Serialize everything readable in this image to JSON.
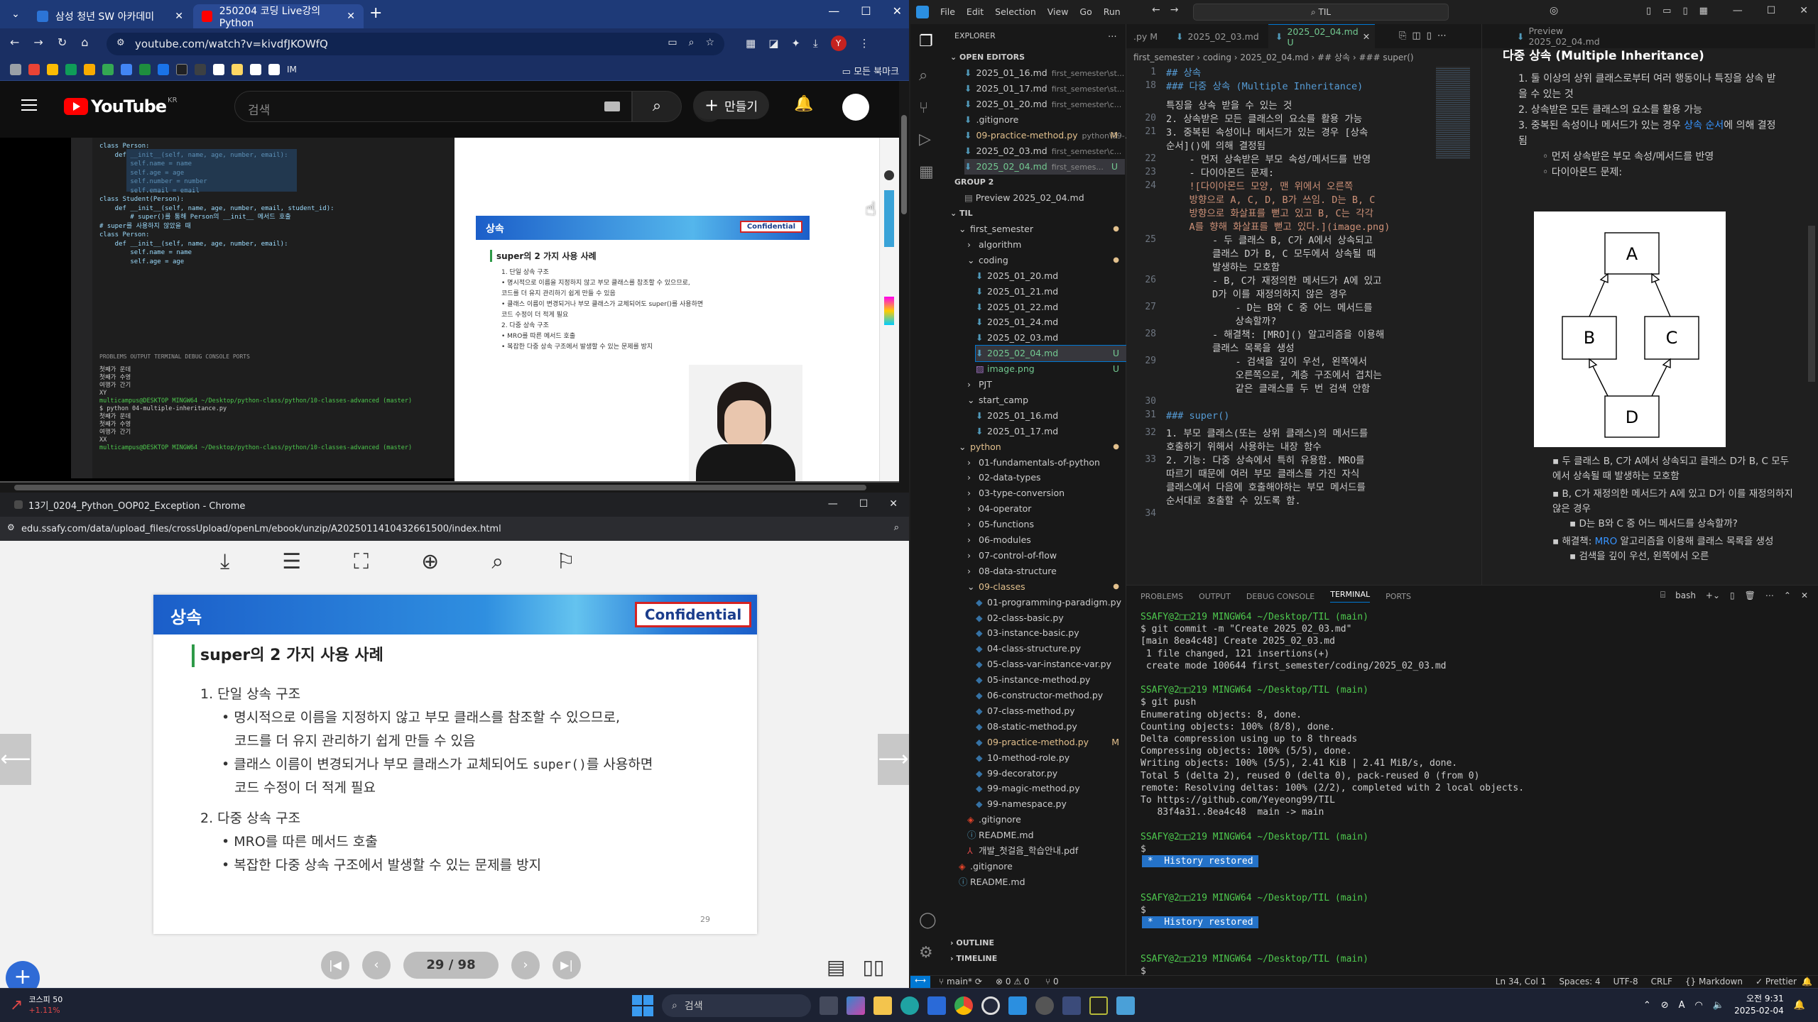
{
  "chrome": {
    "tabs": [
      {
        "label": "삼성 청년 SW 아카데미",
        "active": false
      },
      {
        "label": "250204 코딩 Live강의 Python",
        "active": true
      }
    ],
    "new_tab": "+",
    "url": "youtube.com/watch?v=kivdfJKOWfQ",
    "bookmarks_right": "모든 북마크",
    "bookmark_short": "IM",
    "avatar_letter": "Y"
  },
  "youtube": {
    "logo": "YouTube",
    "region": "KR",
    "search_placeholder": "검색",
    "create_label": "만들기",
    "video": {
      "code_lines": [
        "class Person:",
        "    def __init__(self, name, age, number, email):",
        "        self.name = name",
        "        self.age = age",
        "        self.number = number",
        "        self.email = email",
        "",
        "",
        "class Student(Person):",
        "    def __init__(self, name, age, number, email, student_id):",
        "        # super()를 통해 Person의 __init__ 메서드 호출",
        "",
        "",
        "# super를 사용하지 않았을 때",
        "class Person:",
        "    def __init__(self, name, age, number, email):",
        "        self.name = name",
        "        self.age = age"
      ],
      "term_lines": [
        "첫째가 운데",
        "첫째가 수영",
        "여행가 간기",
        "XY",
        "",
        "multicampus@DESKTOP MINGW64 ~/Desktop/python-class/python/10-classes-advanced (master)",
        "$ python 04-multiple-inheritance.py",
        "첫째가 운데",
        "첫째가 수영",
        "여행가 간기",
        "XX",
        "",
        "multicampus@DESKTOP MINGW64 ~/Desktop/python-class/python/10-classes-advanced (master)"
      ],
      "panel_tabs": "PROBLEMS  OUTPUT  TERMINAL  DEBUG CONSOLE  PORTS",
      "slide_title": "상속",
      "slide_confidential": "Confidential",
      "slide_heading": "super의 2 가지 사용 사례",
      "slide_lines": [
        "1. 단일 상속 구조",
        "• 명시적으로 이름을 지정하지 않고 부모 클래스를 참조할 수 있으므로,",
        "코드를 더 유지 관리하기 쉽게 만들 수 있음",
        "• 클래스 이름이 변경되거나 부모 클래스가 교체되어도 super()를 사용하면",
        "코드 수정이 더 적게 필요",
        "2. 다중 상속 구조",
        "• MRO를 따른 메서드 호출",
        "• 복잡한 다중 상속 구조에서 발생할 수 있는 문제를 방지"
      ]
    }
  },
  "pdf": {
    "window_title": "13기_0204_Python_OOP02_Exception - Chrome",
    "url": "edu.ssafy.com/data/upload_files/crossUpload/openLm/ebook/unzip/A2025011410432661500/index.html",
    "slide": {
      "section": "상속",
      "confidential": "Confidential",
      "heading": "super의 2 가지 사용 사례",
      "item1": "1.   단일 상속 구조",
      "b1a": "• 명시적으로 이름을 지정하지 않고 부모 클래스를 참조할 수 있으므로,",
      "b1b": "코드를 더 유지 관리하기 쉽게 만들 수 있음",
      "b2a_pre": "• 클래스 이름이 변경되거나 부모 클래스가 교체되어도 ",
      "b2a_code": "super()",
      "b2a_post": "를 사용하면",
      "b2b": "코드 수정이 더 적게 필요",
      "item2": "2.   다중 상속 구조",
      "b3": "• MRO를 따른 메서드 호출",
      "b4": "• 복잡한 다중 상속 구조에서 발생할 수 있는 문제를 방지",
      "page_num": "29"
    },
    "pager": "29 / 98"
  },
  "vscode": {
    "menu": [
      "File",
      "Edit",
      "Selection",
      "View",
      "Go",
      "Run"
    ],
    "search": "TIL",
    "explorer_title": "EXPLORER",
    "open_editors": "OPEN EDITORS",
    "open_files": [
      {
        "name": "2025_01_16.md",
        "path": "first_semester\\st...",
        "status": ""
      },
      {
        "name": "2025_01_17.md",
        "path": "first_semester\\st...",
        "status": ""
      },
      {
        "name": "2025_01_20.md",
        "path": "first_semester\\c...",
        "status": ""
      },
      {
        "name": ".gitignore",
        "path": "",
        "status": ""
      },
      {
        "name": "09-practice-method.py",
        "path": "python\\09-...",
        "status": "M"
      },
      {
        "name": "2025_02_03.md",
        "path": "first_semester\\c...",
        "status": ""
      },
      {
        "name": "2025_02_04.md",
        "path": "first_semes...",
        "status": "U"
      }
    ],
    "group2": "GROUP 2",
    "group2_file": "Preview 2025_02_04.md",
    "til": "TIL",
    "tree": [
      {
        "name": "first_semester",
        "depth": 1,
        "kind": "folder-open",
        "mark": "dot"
      },
      {
        "name": "algorithm",
        "depth": 2,
        "kind": "folder"
      },
      {
        "name": "coding",
        "depth": 2,
        "kind": "folder-open",
        "mark": "dot"
      },
      {
        "name": "2025_01_20.md",
        "depth": 3,
        "kind": "md"
      },
      {
        "name": "2025_01_21.md",
        "depth": 3,
        "kind": "md"
      },
      {
        "name": "2025_01_22.md",
        "depth": 3,
        "kind": "md"
      },
      {
        "name": "2025_01_24.md",
        "depth": 3,
        "kind": "md"
      },
      {
        "name": "2025_02_03.md",
        "depth": 3,
        "kind": "md"
      },
      {
        "name": "2025_02_04.md",
        "depth": 3,
        "kind": "md",
        "mark": "U",
        "selected": true
      },
      {
        "name": "image.png",
        "depth": 3,
        "kind": "img",
        "mark": "U"
      },
      {
        "name": "PJT",
        "depth": 2,
        "kind": "folder"
      },
      {
        "name": "start_camp",
        "depth": 2,
        "kind": "folder-open"
      },
      {
        "name": "2025_01_16.md",
        "depth": 3,
        "kind": "md"
      },
      {
        "name": "2025_01_17.md",
        "depth": 3,
        "kind": "md"
      },
      {
        "name": "python",
        "depth": 1,
        "kind": "folder-open",
        "mark": "dot",
        "color": "#e2c08d"
      },
      {
        "name": "01-fundamentals-of-python",
        "depth": 2,
        "kind": "folder"
      },
      {
        "name": "02-data-types",
        "depth": 2,
        "kind": "folder"
      },
      {
        "name": "03-type-conversion",
        "depth": 2,
        "kind": "folder"
      },
      {
        "name": "04-operator",
        "depth": 2,
        "kind": "folder"
      },
      {
        "name": "05-functions",
        "depth": 2,
        "kind": "folder"
      },
      {
        "name": "06-modules",
        "depth": 2,
        "kind": "folder"
      },
      {
        "name": "07-control-of-flow",
        "depth": 2,
        "kind": "folder"
      },
      {
        "name": "08-data-structure",
        "depth": 2,
        "kind": "folder"
      },
      {
        "name": "09-classes",
        "depth": 2,
        "kind": "folder-open",
        "mark": "dot",
        "color": "#e2c08d"
      },
      {
        "name": "01-programming-paradigm.py",
        "depth": 3,
        "kind": "py"
      },
      {
        "name": "02-class-basic.py",
        "depth": 3,
        "kind": "py"
      },
      {
        "name": "03-instance-basic.py",
        "depth": 3,
        "kind": "py"
      },
      {
        "name": "04-class-structure.py",
        "depth": 3,
        "kind": "py"
      },
      {
        "name": "05-class-var-instance-var.py",
        "depth": 3,
        "kind": "py"
      },
      {
        "name": "05-instance-method.py",
        "depth": 3,
        "kind": "py"
      },
      {
        "name": "06-constructor-method.py",
        "depth": 3,
        "kind": "py"
      },
      {
        "name": "07-class-method.py",
        "depth": 3,
        "kind": "py"
      },
      {
        "name": "08-static-method.py",
        "depth": 3,
        "kind": "py"
      },
      {
        "name": "09-practice-method.py",
        "depth": 3,
        "kind": "py",
        "mark": "M",
        "color": "#e2c08d"
      },
      {
        "name": "10-method-role.py",
        "depth": 3,
        "kind": "py"
      },
      {
        "name": "99-decorator.py",
        "depth": 3,
        "kind": "py"
      },
      {
        "name": "99-magic-method.py",
        "depth": 3,
        "kind": "py"
      },
      {
        "name": "99-namespace.py",
        "depth": 3,
        "kind": "py"
      },
      {
        "name": ".gitignore",
        "depth": 2,
        "kind": "git"
      },
      {
        "name": "README.md",
        "depth": 2,
        "kind": "info"
      },
      {
        "name": "개발_첫걸음_학습안내.pdf",
        "depth": 2,
        "kind": "pdf"
      },
      {
        "name": ".gitignore",
        "depth": 1,
        "kind": "git"
      },
      {
        "name": "README.md",
        "depth": 1,
        "kind": "info"
      }
    ],
    "outline": "OUTLINE",
    "timeline": "TIMELINE",
    "editor_tabs": [
      {
        "label": ".py M",
        "active": false
      },
      {
        "label": "2025_02_03.md",
        "active": false
      },
      {
        "label": "2025_02_04.md U",
        "active": true
      },
      {
        "label": "Preview 2025_02_04.md",
        "active": false
      }
    ],
    "breadcrumb": "first_semester  ›  coding  ›  2025_02_04.md  ›  ## 상속  ›  ### super()",
    "code": [
      {
        "n": "1",
        "t": "## 상속",
        "c": "#569cd6"
      },
      {
        "n": "18",
        "t": "### 다중 상속 (Multiple Inheritance)",
        "c": "#569cd6"
      },
      {
        "n": "",
        "t": "특징을 상속 받을 수 있는 것",
        "c": "#ccc"
      },
      {
        "n": "20",
        "t": "2. 상속받은 모든 클래스의 요소를 활용 가능",
        "c": "#ccc"
      },
      {
        "n": "21",
        "t": "3. 중복된 속성이나 메서드가 있는 경우 [상속",
        "c": "#ccc"
      },
      {
        "n": "",
        "t": "순서]()에 의해 결정됨",
        "c": "#ccc"
      },
      {
        "n": "22",
        "t": "    - 먼저 상속받은 부모 속성/메서드를 반영",
        "c": "#ccc"
      },
      {
        "n": "23",
        "t": "    - 다이아몬드 문제:",
        "c": "#ccc"
      },
      {
        "n": "24",
        "t": "    ![다이아몬드 모양, 맨 위에서 오른쪽",
        "c": "#ce9178"
      },
      {
        "n": "",
        "t": "    방향으로 A, C, D, B가 쓰임. D는 B, C",
        "c": "#ce9178"
      },
      {
        "n": "",
        "t": "    방향으로 화살표를 뻗고 있고 B, C는 각각",
        "c": "#ce9178"
      },
      {
        "n": "",
        "t": "    A를 향해 화살표를 뻗고 있다.](image.png)",
        "c": "#ce9178"
      },
      {
        "n": "25",
        "t": "        - 두 클래스 B, C가 A에서 상속되고",
        "c": "#ccc"
      },
      {
        "n": "",
        "t": "        클래스 D가 B, C 모두에서 상속될 때",
        "c": "#ccc"
      },
      {
        "n": "",
        "t": "        발생하는 모호함",
        "c": "#ccc"
      },
      {
        "n": "26",
        "t": "        - B, C가 재정의한 메서드가 A에 있고",
        "c": "#ccc"
      },
      {
        "n": "",
        "t": "        D가 이를 재정의하지 않은 경우",
        "c": "#ccc"
      },
      {
        "n": "27",
        "t": "            - D는 B와 C 중 어느 메서드를",
        "c": "#ccc"
      },
      {
        "n": "",
        "t": "            상속할까?",
        "c": "#ccc"
      },
      {
        "n": "28",
        "t": "        - 해결책: [MRO]() 알고리즘을 이용해",
        "c": "#ccc"
      },
      {
        "n": "",
        "t": "        클래스 목록을 생성",
        "c": "#ccc"
      },
      {
        "n": "29",
        "t": "            - 검색을 깊이 우선, 왼쪽에서",
        "c": "#ccc"
      },
      {
        "n": "",
        "t": "            오른쪽으로, 계층 구조에서 겹치는",
        "c": "#ccc"
      },
      {
        "n": "",
        "t": "            같은 클래스를 두 번 검색 안함",
        "c": "#ccc"
      },
      {
        "n": "30",
        "t": "",
        "c": "#ccc"
      },
      {
        "n": "31",
        "t": "### super()",
        "c": "#569cd6"
      },
      {
        "n": "32",
        "t": "1. 부모 클래스(또는 상위 클래스)의 메서드를",
        "c": "#ccc"
      },
      {
        "n": "",
        "t": "호출하기 위해서 사용하는 내장 함수",
        "c": "#ccc"
      },
      {
        "n": "33",
        "t": "2. 기능: 다중 상속에서 특히 유용함. MRO를",
        "c": "#ccc"
      },
      {
        "n": "",
        "t": "따르기 때문에 여러 부모 클래스를 가진 자식",
        "c": "#ccc"
      },
      {
        "n": "",
        "t": "클래스에서 다음에 호출해야하는 부모 메서드를",
        "c": "#ccc"
      },
      {
        "n": "",
        "t": "순서대로 호출할 수 있도록 함.",
        "c": "#ccc"
      },
      {
        "n": "34",
        "t": "",
        "c": "#ccc"
      }
    ],
    "preview": {
      "heading": "다중 상속 (Multiple Inheritance)",
      "items": [
        "1. 둘 이상의 상위 클래스로부터 여러 행동이나 특징을 상속 받을 수 있는 것",
        "2. 상속받은 모든 클래스의 요소를 활용 가능",
        "3. 중복된 속성이나 메서드가 있는 경우 상속 순서에 의해 결정됨"
      ],
      "sub1": "먼저 상속받은 부모 속성/메서드를 반영",
      "sub2": "다이아몬드 문제:",
      "diagram": {
        "a": "A",
        "b": "B",
        "c": "C",
        "d": "D"
      },
      "bul1": "두 클래스 B, C가 A에서 상속되고 클래스 D가 B, C 모두에서 상속될 때 발생하는 모호함",
      "bul2": "B, C가 재정의한 메서드가 A에 있고 D가 이를 재정의하지 않은 경우",
      "bul2a": "D는 B와 C 중 어느 메서드를 상속할까?",
      "bul3_pre": "해결책: ",
      "bul3_link": "MRO",
      "bul3_post": " 알고리즘을 이용해 클래스 목록을 생성",
      "bul3a": "검색을 깊이 우선, 왼쪽에서 오른"
    },
    "panel_tabs": [
      "PROBLEMS",
      "OUTPUT",
      "DEBUG CONSOLE",
      "TERMINAL",
      "PORTS"
    ],
    "shell": "bash",
    "terminal": [
      {
        "t": "SSAFY@2□□219 MINGW64 ~/Desktop/TIL (main)",
        "k": "prompt"
      },
      {
        "t": "$ git commit -m \"Create 2025_02_03.md\"",
        "k": "plain"
      },
      {
        "t": "[main 8ea4c48] Create 2025_02_03.md",
        "k": "plain"
      },
      {
        "t": " 1 file changed, 121 insertions(+)",
        "k": "plain"
      },
      {
        "t": " create mode 100644 first_semester/coding/2025_02_03.md",
        "k": "plain"
      },
      {
        "t": "",
        "k": "plain"
      },
      {
        "t": "SSAFY@2□□219 MINGW64 ~/Desktop/TIL (main)",
        "k": "prompt"
      },
      {
        "t": "$ git push",
        "k": "plain"
      },
      {
        "t": "Enumerating objects: 8, done.",
        "k": "plain"
      },
      {
        "t": "Counting objects: 100% (8/8), done.",
        "k": "plain"
      },
      {
        "t": "Delta compression using up to 8 threads",
        "k": "plain"
      },
      {
        "t": "Compressing objects: 100% (5/5), done.",
        "k": "plain"
      },
      {
        "t": "Writing objects: 100% (5/5), 2.41 KiB | 2.41 MiB/s, done.",
        "k": "plain"
      },
      {
        "t": "Total 5 (delta 2), reused 0 (delta 0), pack-reused 0 (from 0)",
        "k": "plain"
      },
      {
        "t": "remote: Resolving deltas: 100% (2/2), completed with 2 local objects.",
        "k": "plain"
      },
      {
        "t": "To https://github.com/Yeyeong99/TIL",
        "k": "plain"
      },
      {
        "t": "   83f4a31..8ea4c48  main -> main",
        "k": "plain"
      },
      {
        "t": "",
        "k": "plain"
      },
      {
        "t": "SSAFY@2□□219 MINGW64 ~/Desktop/TIL (main)",
        "k": "prompt"
      },
      {
        "t": "$",
        "k": "plain"
      },
      {
        "t": " *  History restored ",
        "k": "hist"
      },
      {
        "t": "",
        "k": "plain"
      },
      {
        "t": "",
        "k": "plain"
      },
      {
        "t": "SSAFY@2□□219 MINGW64 ~/Desktop/TIL (main)",
        "k": "prompt"
      },
      {
        "t": "$",
        "k": "plain"
      },
      {
        "t": " *  History restored ",
        "k": "hist"
      },
      {
        "t": "",
        "k": "plain"
      },
      {
        "t": "",
        "k": "plain"
      },
      {
        "t": "SSAFY@2□□219 MINGW64 ~/Desktop/TIL (main)",
        "k": "prompt"
      },
      {
        "t": "$",
        "k": "plain"
      }
    ],
    "status": {
      "branch": "main*",
      "errors": "⊗ 0 ⚠ 0",
      "ports": "⑂ 0",
      "right": [
        "Ln 34, Col 1",
        "Spaces: 4",
        "UTF-8",
        "CRLF",
        "{} Markdown",
        "✓ Prettier"
      ]
    }
  },
  "taskbar": {
    "stock_name": "코스피 50",
    "stock_change": "+1.11%",
    "search": "검색",
    "time": "오전 9:31",
    "date": "2025-02-04",
    "ime": "A"
  },
  "colors": {
    "accent": "#0078d4",
    "ssafy_blue": "#1b5ec9",
    "confidential_red": "#d42323",
    "yt_red": "#ff0000"
  }
}
